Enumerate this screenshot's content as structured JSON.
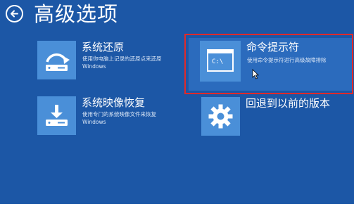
{
  "header": {
    "title": "高级选项",
    "back_icon": "back-arrow-icon"
  },
  "options": [
    {
      "title": "系统还原",
      "description": "使用你电脑上记录的还原点来还原 Windows",
      "icon": "system-restore-icon"
    },
    {
      "title": "命令提示符",
      "description": "使用命令提示符进行高级故障排除",
      "icon": "command-prompt-icon",
      "icon_text": "C:\\"
    },
    {
      "title": "系统映像恢复",
      "description": "使用专门的系统映像文件来恢复 Windows",
      "icon": "system-image-recovery-icon"
    },
    {
      "title": "回退到以前的版本",
      "description": "",
      "icon": "gear-icon"
    }
  ],
  "colors": {
    "background": "#1c57a6",
    "tile": "#4a8fd8",
    "highlight": "#2b6bbd",
    "annotation_frame": "#e02a2a",
    "text": "#ffffff"
  }
}
